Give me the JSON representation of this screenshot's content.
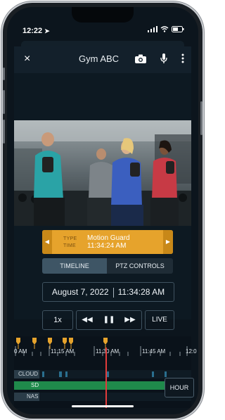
{
  "status_bar": {
    "time": "12:22",
    "location_arrow": "➤"
  },
  "header": {
    "title": "Gym ABC",
    "close_icon": "×",
    "camera_icon": "camera-icon",
    "mic_icon": "microphone-icon",
    "more_icon": "more-vertical-icon"
  },
  "event": {
    "type_label": "TYPE",
    "time_label": "TIME",
    "type_value": "Motion Guard",
    "time_value": "11:34:24 AM",
    "prev": "◀",
    "next": "▶"
  },
  "tabs": [
    {
      "label": "TIMELINE",
      "active": true
    },
    {
      "label": "PTZ CONTROLS",
      "active": false
    }
  ],
  "current": {
    "date": "August 7, 2022",
    "time": "11:34:28 AM"
  },
  "playback": {
    "speed": "1x",
    "rewind": "◀◀",
    "pause": "❚❚",
    "forward": "▶▶",
    "live": "LIVE"
  },
  "timeline": {
    "tick_labels": [
      "0 AM",
      "11:15 AM",
      "11:30 AM",
      "11:45 AM",
      "12:0"
    ],
    "tracks": [
      "CLOUD",
      "SD",
      "NAS"
    ],
    "zoom_label": "HOUR"
  },
  "colors": {
    "accent": "#e6a32c",
    "sd_track": "#1f8a4b",
    "cloud_track": "#2a6f8f",
    "playhead": "#e23b3b"
  }
}
